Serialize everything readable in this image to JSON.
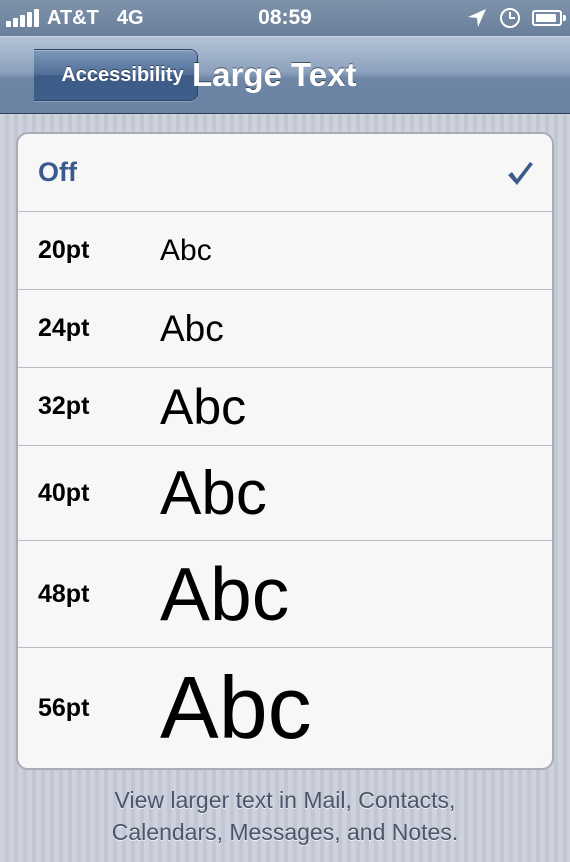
{
  "status_bar": {
    "carrier": "AT&T",
    "network": "4G",
    "time": "08:59",
    "icons": [
      "signal-bars-icon",
      "location-arrow-icon",
      "clock-icon",
      "battery-icon"
    ],
    "battery_level": 0.9
  },
  "nav": {
    "back_label": "Accessibility",
    "title": "Large Text"
  },
  "options": [
    {
      "label": "Off",
      "sample": "",
      "selected": true
    },
    {
      "label": "20pt",
      "sample": "Abc",
      "selected": false
    },
    {
      "label": "24pt",
      "sample": "Abc",
      "selected": false
    },
    {
      "label": "32pt",
      "sample": "Abc",
      "selected": false
    },
    {
      "label": "40pt",
      "sample": "Abc",
      "selected": false
    },
    {
      "label": "48pt",
      "sample": "Abc",
      "selected": false
    },
    {
      "label": "56pt",
      "sample": "Abc",
      "selected": false
    }
  ],
  "footer": {
    "line1": "View larger text in Mail, Contacts,",
    "line2": "Calendars, Messages, and Notes."
  },
  "colors": {
    "selected_text": "#3c5a8c",
    "nav_bar": "#6e86a5",
    "background": "#c7ccd8"
  }
}
